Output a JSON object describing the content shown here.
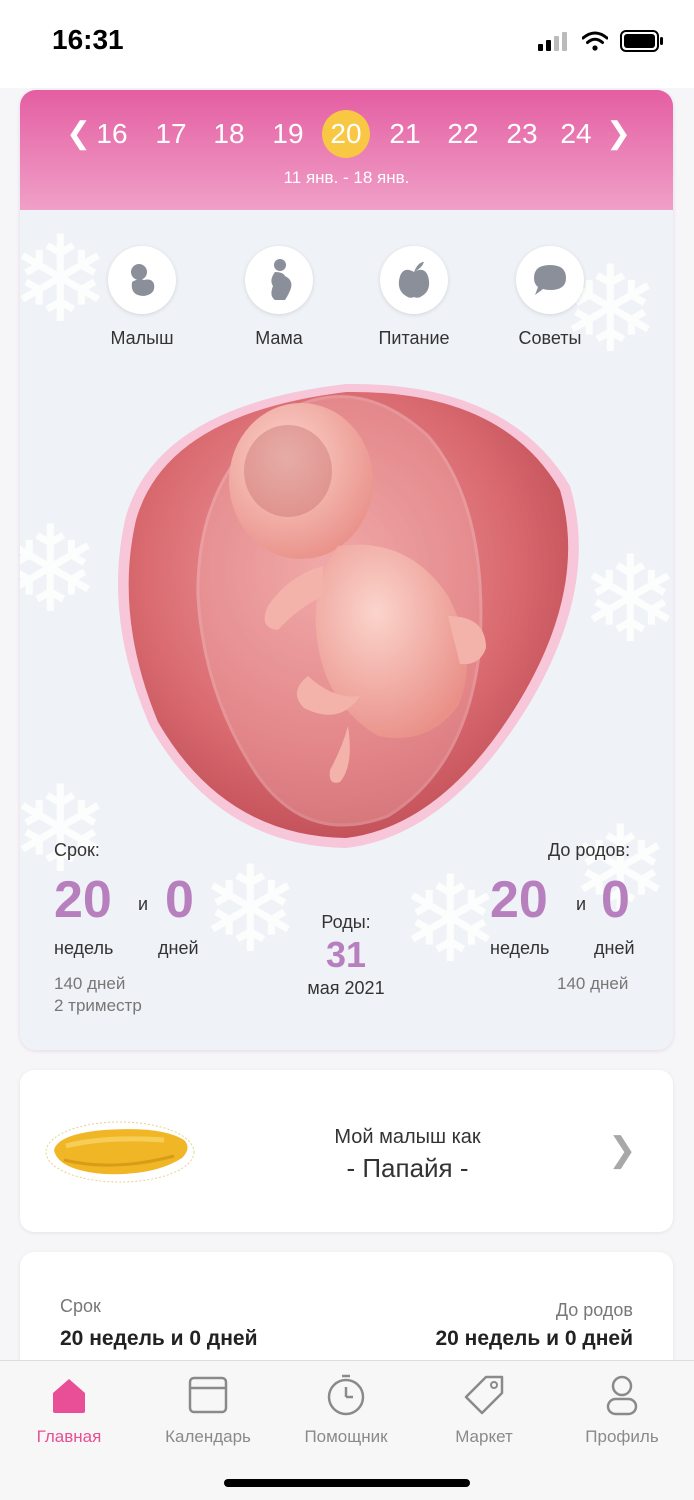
{
  "status_bar": {
    "time": "16:31"
  },
  "week_selector": {
    "weeks": [
      "16",
      "17",
      "18",
      "19",
      "20",
      "21",
      "22",
      "23",
      "24"
    ],
    "selected_week": "20",
    "date_range": "11 янв. - 18 янв."
  },
  "categories": [
    {
      "label": "Малыш",
      "icon": "baby-icon"
    },
    {
      "label": "Мама",
      "icon": "pregnant-mother-icon"
    },
    {
      "label": "Питание",
      "icon": "apple-icon"
    },
    {
      "label": "Советы",
      "icon": "speech-bubble-icon"
    }
  ],
  "term": {
    "label": "Срок:",
    "weeks": "20",
    "and": "и",
    "days": "0",
    "weeks_unit": "недель",
    "days_unit": "дней",
    "total_days": "140 дней",
    "trimester": "2 триместр"
  },
  "due": {
    "label": "Роды:",
    "day": "31",
    "month_year": "мая 2021"
  },
  "until_birth": {
    "label": "До родов:",
    "weeks": "20",
    "and": "и",
    "days": "0",
    "weeks_unit": "недель",
    "days_unit": "дней",
    "total_days": "140 дней"
  },
  "size_card": {
    "label": "Мой малыш как",
    "fruit": "- Папайя -",
    "fruit_icon": "papaya-icon"
  },
  "summary": {
    "term_label": "Срок",
    "term_value": "20 недель и 0 дней",
    "until_label": "До родов",
    "until_value": "20 недель и 0 дней"
  },
  "tabs": [
    {
      "label": "Главная",
      "icon": "home-icon",
      "active": true
    },
    {
      "label": "Календарь",
      "icon": "calendar-icon",
      "active": false
    },
    {
      "label": "Помощник",
      "icon": "stopwatch-icon",
      "active": false
    },
    {
      "label": "Маркет",
      "icon": "tag-icon",
      "active": false
    },
    {
      "label": "Профиль",
      "icon": "user-icon",
      "active": false
    }
  ],
  "colors": {
    "accent_pink": "#e84f96",
    "header_gradient_top": "#e45ea2",
    "selected_week": "#f8c744",
    "number_purple": "#b77fbe"
  }
}
